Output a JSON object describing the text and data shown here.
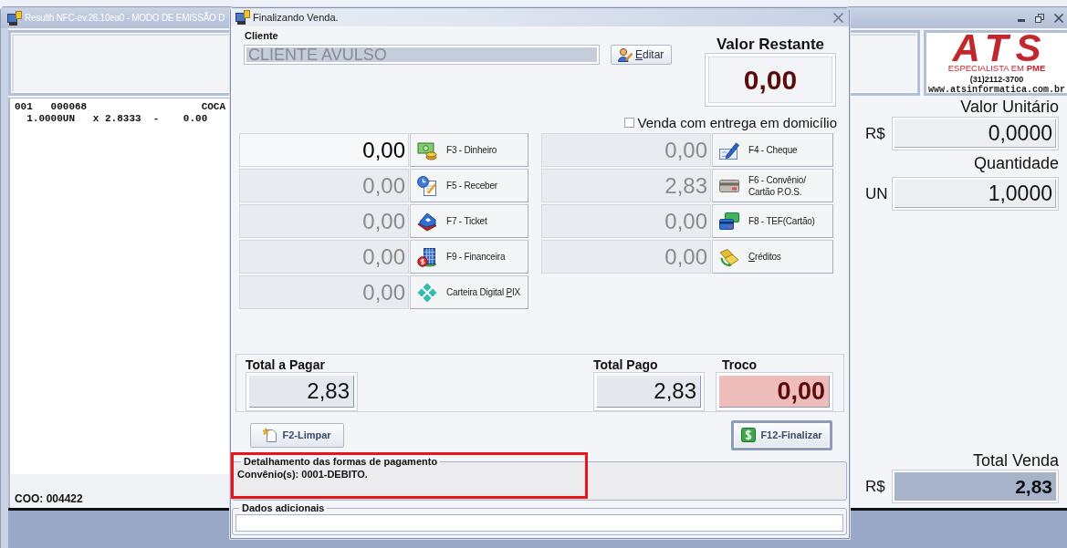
{
  "main_window": {
    "title": "Resulth NFC-ev.26.10ea0 - MODO DE EMISSÃO D",
    "logo": {
      "brand": "ATS",
      "tagline": "ESPECIALISTA EM **PME**",
      "phone": "(31)2112-3700",
      "website": "www.atsinformatica.com.br"
    },
    "receipt": {
      "lines": [
        "001   000068                   COCA",
        "  1.0000UN   x 2.8333  -    0.00"
      ],
      "coo": "COO: 004422"
    },
    "unit_price": {
      "label": "Valor Unitário",
      "unit": "R$",
      "value": "0,0000"
    },
    "quantity": {
      "label": "Quantidade",
      "unit": "UN",
      "value": "1,0000"
    },
    "total_sale": {
      "label": "Total Venda",
      "unit": "R$",
      "value": "2,83"
    }
  },
  "dialog": {
    "title": "Finalizando Venda.",
    "client": {
      "label": "Cliente",
      "value": "CLIENTE AVULSO"
    },
    "edit_button": {
      "label": [
        {
          "text": "E",
          "underline": true
        },
        {
          "text": "ditar",
          "underline": false
        }
      ]
    },
    "remaining": {
      "label": "Valor Restante",
      "value": "0,00"
    },
    "home_delivery": {
      "label": "Venda com entrega em domicílio",
      "checked": false
    },
    "payments_left": [
      {
        "kind": "cash",
        "value": "0,00",
        "active": true,
        "label": [
          {
            "text": "F3 - Dinheiro",
            "underline": false
          }
        ]
      },
      {
        "kind": "receivable",
        "value": "0,00",
        "active": false,
        "label": [
          {
            "text": "F5 - Receber",
            "underline": false
          }
        ]
      },
      {
        "kind": "ticket",
        "value": "0,00",
        "active": false,
        "label": [
          {
            "text": "F7 - Ticket",
            "underline": false
          }
        ]
      },
      {
        "kind": "financing",
        "value": "0,00",
        "active": false,
        "label": [
          {
            "text": "F9 - Financeira",
            "underline": false
          }
        ]
      },
      {
        "kind": "pix",
        "value": "0,00",
        "active": false,
        "label": [
          {
            "text": "Carteira Digital ",
            "underline": false
          },
          {
            "text": "P",
            "underline": true
          },
          {
            "text": "IX",
            "underline": false
          }
        ]
      }
    ],
    "payments_right": [
      {
        "kind": "cheque",
        "value": "0,00",
        "active": false,
        "label": [
          {
            "text": "F4 - Cheque",
            "underline": false
          }
        ]
      },
      {
        "kind": "card",
        "value": "2,83",
        "active": false,
        "label": [
          {
            "text": "F6 - Convênio/\nCartão P.O.S.",
            "underline": false
          }
        ]
      },
      {
        "kind": "tef",
        "value": "0,00",
        "active": false,
        "label": [
          {
            "text": "F8 - TEF(Cartão)",
            "underline": false
          }
        ]
      },
      {
        "kind": "credits",
        "value": "0,00",
        "active": false,
        "label": [
          {
            "text": "C",
            "underline": true
          },
          {
            "text": "réditos",
            "underline": false
          }
        ]
      }
    ],
    "totals": {
      "to_pay": {
        "label": "Total a Pagar",
        "value": "2,83"
      },
      "paid": {
        "label": "Total Pago",
        "value": "2,83"
      },
      "change": {
        "label": "Troco",
        "value": "0,00"
      }
    },
    "buttons": [
      {
        "kind": "clear",
        "default": false,
        "label": [
          {
            "text": "F2-Limpar",
            "underline": false
          }
        ]
      },
      {
        "kind": "finish",
        "default": true,
        "label": [
          {
            "text": "F12-Finalizar",
            "underline": false
          }
        ]
      }
    ],
    "payment_details": {
      "title": "Detalhamento das formas de pagamento",
      "text": "Convênio(s): 0001-DEBITO.",
      "highlighted": true
    },
    "additional_data": {
      "title": "Dados adicionais"
    }
  }
}
